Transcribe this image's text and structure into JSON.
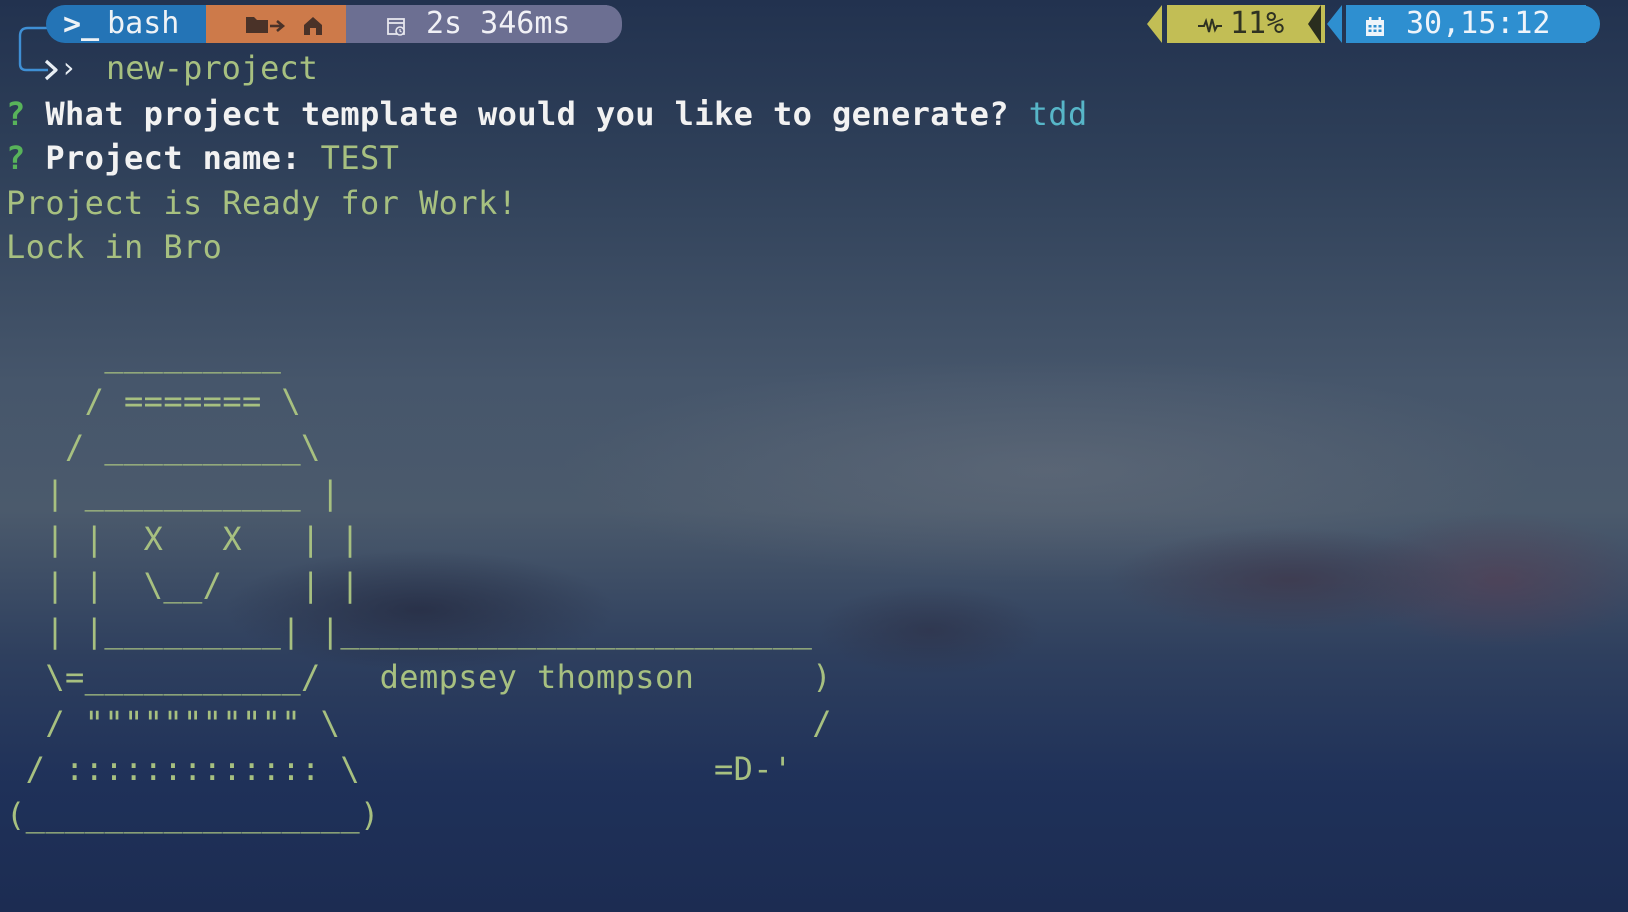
{
  "prompt": {
    "shell_name": "bash",
    "terminal_icon": ">_",
    "folder_icon": "folder-arrow-icon",
    "home_icon": "home-icon",
    "timer_icon": "stopwatch-icon",
    "exec_time": "2s 346ms",
    "cpu_icon": "pulse-icon",
    "cpu_usage": "11%",
    "calendar_icon": "calendar-icon",
    "clock": "30,15:12",
    "command_chevron": "›",
    "command": "new-project"
  },
  "output": {
    "q1_mark": "?",
    "q1_text": "What project template would you like to generate?",
    "q1_answer": "tdd",
    "q2_mark": "?",
    "q2_text": "Project name:",
    "q2_answer": "TEST",
    "ready_line": "Project is Ready for Work!",
    "lock_line": "Lock in Bro",
    "ascii_art": "     _________\n    / ======= \\\n   / __________\\\n  | ___________ |\n  | |  X   X   | |\n  | |  \\__/    | |\n  | |_________| |________________________\n  \\=___________/   dempsey thompson      )\n  / \"\"\"\"\"\"\"\"\"\"\" \\                        /\n / ::::::::::::: \\                  =D-'\n(_________________)"
  },
  "colors": {
    "bash_segment": "#2474b6",
    "dir_segment": "#cd7a4a",
    "time_segment": "#6c6f92",
    "cpu_segment": "#c2be55",
    "clock_segment": "#2e8fd0",
    "prompt_green": "#58b35a",
    "answer_blue": "#57b6c8",
    "output_green": "#a7c080"
  }
}
